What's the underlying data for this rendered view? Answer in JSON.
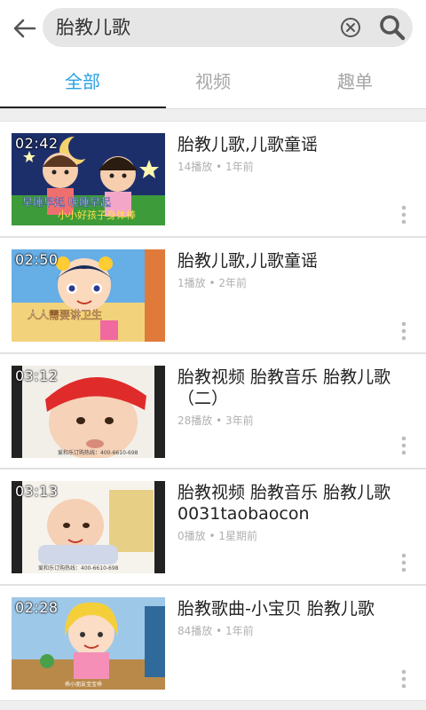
{
  "search": {
    "query": "胎教儿歌"
  },
  "tabs": [
    {
      "label": "全部",
      "active": true
    },
    {
      "label": "视频",
      "active": false
    },
    {
      "label": "趣单",
      "active": false
    }
  ],
  "colors": {
    "accent": "#2aa3e0",
    "inactive_tab": "#a6a6a6",
    "meta": "#b0b0b0"
  },
  "icons": {
    "back": "arrow-left-icon",
    "clear": "clear-circle-x-icon",
    "search": "search-magnifier-icon",
    "more": "vertical-dots-icon"
  },
  "videos": [
    {
      "duration": "02:42",
      "title": "胎教儿歌,儿歌童谣",
      "meta": "14播放 • 1年前",
      "thumb_text_1": "早睡早起 晚睡早起",
      "thumb_text_2": "小小好孩子身体棒"
    },
    {
      "duration": "02:50",
      "title": "胎教儿歌,儿歌童谣",
      "meta": "1播放 • 2年前",
      "thumb_text_1": "人人需要讲卫生"
    },
    {
      "duration": "03:12",
      "title": "胎教视频 胎教音乐 胎教儿歌（二）",
      "meta": "28播放 • 3年前",
      "thumb_text_1": "爱和乐订购热线：400-6610-698"
    },
    {
      "duration": "03:13",
      "title": "胎教视频 胎教音乐 胎教儿歌0031taobaocon",
      "meta": "0播放 • 1星期前",
      "thumb_text_1": "爱和乐订购热线：400-6610-698"
    },
    {
      "duration": "02:28",
      "title": "胎教歌曲-小宝贝 胎教儿歌",
      "meta": "84播放 • 1年前",
      "thumb_text_1": "乖小朋友宝宝乖"
    }
  ]
}
